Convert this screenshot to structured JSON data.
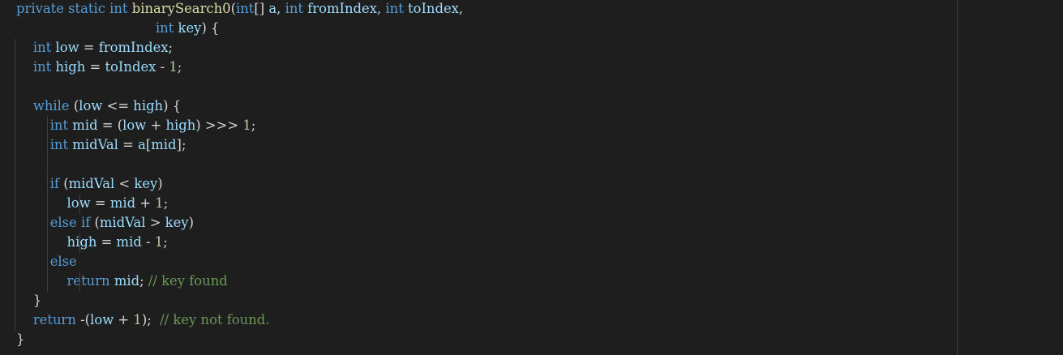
{
  "editor": {
    "colors": {
      "background": "#1e1e1e",
      "keyword": "#569cd6",
      "function": "#dcdcaa",
      "identifier": "#d4d4d4",
      "variable": "#9cdcfe",
      "number": "#b5cea8",
      "comment": "#6a9955",
      "indent_guide": "#404040",
      "ruler": "#3a3a3a"
    },
    "lines": [
      {
        "tokens": [
          {
            "t": "private",
            "k": "kw"
          },
          {
            "t": " ",
            "k": "op"
          },
          {
            "t": "static",
            "k": "kw"
          },
          {
            "t": " ",
            "k": "op"
          },
          {
            "t": "int",
            "k": "ty"
          },
          {
            "t": " ",
            "k": "op"
          },
          {
            "t": "binarySearch0",
            "k": "fn"
          },
          {
            "t": "(",
            "k": "op"
          },
          {
            "t": "int",
            "k": "ty"
          },
          {
            "t": "[] ",
            "k": "op"
          },
          {
            "t": "a",
            "k": "var"
          },
          {
            "t": ", ",
            "k": "op"
          },
          {
            "t": "int",
            "k": "ty"
          },
          {
            "t": " ",
            "k": "op"
          },
          {
            "t": "fromIndex",
            "k": "var"
          },
          {
            "t": ", ",
            "k": "op"
          },
          {
            "t": "int",
            "k": "ty"
          },
          {
            "t": " ",
            "k": "op"
          },
          {
            "t": "toIndex",
            "k": "var"
          },
          {
            "t": ",",
            "k": "op"
          }
        ]
      },
      {
        "tokens": [
          {
            "t": "                                 ",
            "k": "op"
          },
          {
            "t": "int",
            "k": "ty"
          },
          {
            "t": " ",
            "k": "op"
          },
          {
            "t": "key",
            "k": "var"
          },
          {
            "t": ") {",
            "k": "op"
          }
        ]
      },
      {
        "tokens": [
          {
            "t": "    ",
            "k": "op"
          },
          {
            "t": "int",
            "k": "ty"
          },
          {
            "t": " ",
            "k": "op"
          },
          {
            "t": "low",
            "k": "var"
          },
          {
            "t": " = ",
            "k": "op"
          },
          {
            "t": "fromIndex",
            "k": "var"
          },
          {
            "t": ";",
            "k": "op"
          }
        ]
      },
      {
        "tokens": [
          {
            "t": "    ",
            "k": "op"
          },
          {
            "t": "int",
            "k": "ty"
          },
          {
            "t": " ",
            "k": "op"
          },
          {
            "t": "high",
            "k": "var"
          },
          {
            "t": " = ",
            "k": "op"
          },
          {
            "t": "toIndex",
            "k": "var"
          },
          {
            "t": " - ",
            "k": "op"
          },
          {
            "t": "1",
            "k": "nm"
          },
          {
            "t": ";",
            "k": "op"
          }
        ]
      },
      {
        "tokens": []
      },
      {
        "tokens": [
          {
            "t": "    ",
            "k": "op"
          },
          {
            "t": "while",
            "k": "kw"
          },
          {
            "t": " (",
            "k": "op"
          },
          {
            "t": "low",
            "k": "var"
          },
          {
            "t": " <= ",
            "k": "op"
          },
          {
            "t": "high",
            "k": "var"
          },
          {
            "t": ") {",
            "k": "op"
          }
        ]
      },
      {
        "tokens": [
          {
            "t": "        ",
            "k": "op"
          },
          {
            "t": "int",
            "k": "ty"
          },
          {
            "t": " ",
            "k": "op"
          },
          {
            "t": "mid",
            "k": "var"
          },
          {
            "t": " = (",
            "k": "op"
          },
          {
            "t": "low",
            "k": "var"
          },
          {
            "t": " + ",
            "k": "op"
          },
          {
            "t": "high",
            "k": "var"
          },
          {
            "t": ") >>> ",
            "k": "op"
          },
          {
            "t": "1",
            "k": "nm"
          },
          {
            "t": ";",
            "k": "op"
          }
        ]
      },
      {
        "tokens": [
          {
            "t": "        ",
            "k": "op"
          },
          {
            "t": "int",
            "k": "ty"
          },
          {
            "t": " ",
            "k": "op"
          },
          {
            "t": "midVal",
            "k": "var"
          },
          {
            "t": " = ",
            "k": "op"
          },
          {
            "t": "a",
            "k": "var"
          },
          {
            "t": "[",
            "k": "op"
          },
          {
            "t": "mid",
            "k": "var"
          },
          {
            "t": "];",
            "k": "op"
          }
        ]
      },
      {
        "tokens": []
      },
      {
        "tokens": [
          {
            "t": "        ",
            "k": "op"
          },
          {
            "t": "if",
            "k": "kw"
          },
          {
            "t": " (",
            "k": "op"
          },
          {
            "t": "midVal",
            "k": "var"
          },
          {
            "t": " < ",
            "k": "op"
          },
          {
            "t": "key",
            "k": "var"
          },
          {
            "t": ")",
            "k": "op"
          }
        ]
      },
      {
        "tokens": [
          {
            "t": "            ",
            "k": "op"
          },
          {
            "t": "low",
            "k": "var"
          },
          {
            "t": " = ",
            "k": "op"
          },
          {
            "t": "mid",
            "k": "var"
          },
          {
            "t": " + ",
            "k": "op"
          },
          {
            "t": "1",
            "k": "nm"
          },
          {
            "t": ";",
            "k": "op"
          }
        ]
      },
      {
        "tokens": [
          {
            "t": "        ",
            "k": "op"
          },
          {
            "t": "else",
            "k": "kw"
          },
          {
            "t": " ",
            "k": "op"
          },
          {
            "t": "if",
            "k": "kw"
          },
          {
            "t": " (",
            "k": "op"
          },
          {
            "t": "midVal",
            "k": "var"
          },
          {
            "t": " > ",
            "k": "op"
          },
          {
            "t": "key",
            "k": "var"
          },
          {
            "t": ")",
            "k": "op"
          }
        ]
      },
      {
        "tokens": [
          {
            "t": "            ",
            "k": "op"
          },
          {
            "t": "high",
            "k": "var"
          },
          {
            "t": " = ",
            "k": "op"
          },
          {
            "t": "mid",
            "k": "var"
          },
          {
            "t": " - ",
            "k": "op"
          },
          {
            "t": "1",
            "k": "nm"
          },
          {
            "t": ";",
            "k": "op"
          }
        ]
      },
      {
        "tokens": [
          {
            "t": "        ",
            "k": "op"
          },
          {
            "t": "else",
            "k": "kw"
          }
        ]
      },
      {
        "tokens": [
          {
            "t": "            ",
            "k": "op"
          },
          {
            "t": "return",
            "k": "kw"
          },
          {
            "t": " ",
            "k": "op"
          },
          {
            "t": "mid",
            "k": "var"
          },
          {
            "t": "; ",
            "k": "op"
          },
          {
            "t": "// key found",
            "k": "cm"
          }
        ]
      },
      {
        "tokens": [
          {
            "t": "    ",
            "k": "op"
          },
          {
            "t": "}",
            "k": "op"
          }
        ]
      },
      {
        "tokens": [
          {
            "t": "    ",
            "k": "op"
          },
          {
            "t": "return",
            "k": "kw"
          },
          {
            "t": " -(",
            "k": "op"
          },
          {
            "t": "low",
            "k": "var"
          },
          {
            "t": " + ",
            "k": "op"
          },
          {
            "t": "1",
            "k": "nm"
          },
          {
            "t": ");  ",
            "k": "op"
          },
          {
            "t": "// key not found.",
            "k": "cm"
          }
        ]
      },
      {
        "tokens": [
          {
            "t": "}",
            "k": "op"
          }
        ]
      }
    ]
  }
}
